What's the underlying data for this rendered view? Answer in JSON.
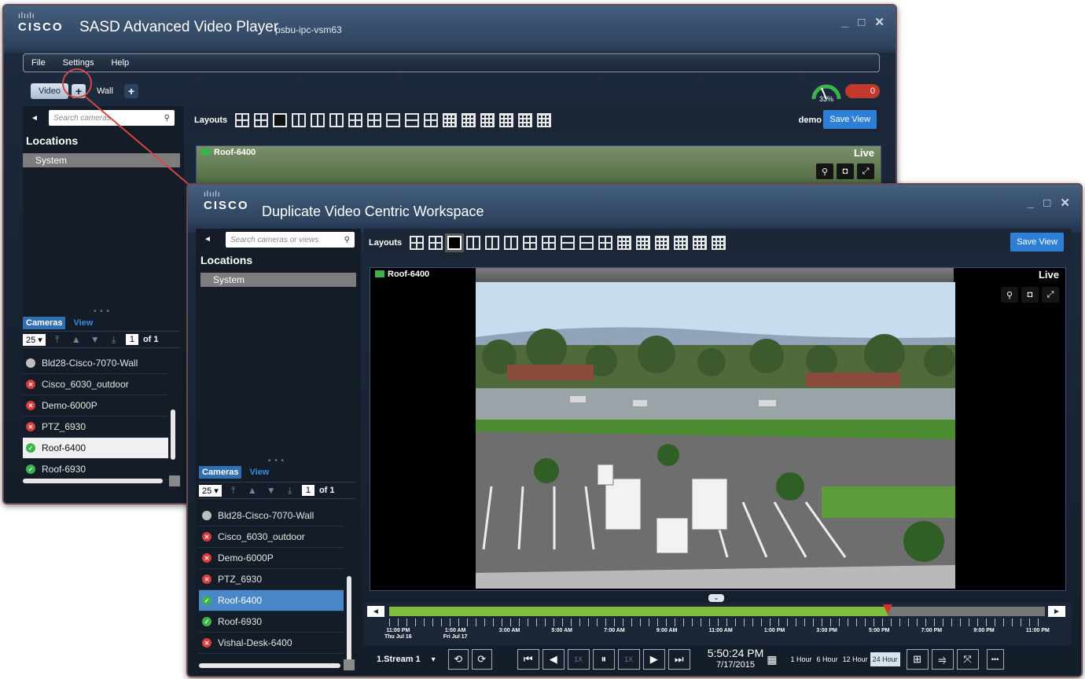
{
  "back_window": {
    "logo_bars": "ılıılı",
    "logo_word": "CISCO",
    "title": "SASD Advanced Video Player",
    "host": "psbu-ipc-vsm63",
    "window_controls": "_ □ ✕",
    "menu": [
      "File",
      "Settings",
      "Help"
    ],
    "tabs": [
      "Video",
      "Wall"
    ],
    "plus": "+",
    "gauge_percent": "33%",
    "alert_count": "0",
    "collapse_arrow": "◄",
    "search_placeholder": "Search cameras",
    "search_icon": "⚲",
    "locations_heading": "Locations",
    "locations": [
      "System"
    ],
    "splitter": "• • •",
    "camera_tabs": [
      "Cameras",
      "View"
    ],
    "pager": {
      "per_page": "25 ▾",
      "first": "⤒",
      "prev": "▲",
      "next": "▼",
      "last": "⤓",
      "page": "1",
      "of": "of 1"
    },
    "cameras": [
      {
        "name": "Bld28-Cisco-7070-Wall",
        "status": "gray",
        "glyph": ""
      },
      {
        "name": "Cisco_6030_outdoor",
        "status": "red",
        "glyph": "✕"
      },
      {
        "name": "Demo-6000P",
        "status": "red",
        "glyph": "✕"
      },
      {
        "name": "PTZ_6930",
        "status": "red",
        "glyph": "✕"
      },
      {
        "name": "Roof-6400",
        "status": "green",
        "glyph": "✓",
        "selected": true
      },
      {
        "name": "Roof-6930",
        "status": "green",
        "glyph": "✓"
      }
    ],
    "layouts_label": "Layouts",
    "user": "demo",
    "save_view": "Save View",
    "tile": {
      "name": "Roof-6400",
      "status": "Live",
      "tools": [
        "⚲",
        "◘",
        "⤢"
      ]
    }
  },
  "front_window": {
    "logo_bars": "ılıılı",
    "logo_word": "CISCO",
    "title": "Duplicate Video Centric Workspace",
    "window_controls": "_ □ ✕",
    "collapse_arrow": "◄",
    "search_placeholder": "Search cameras or views",
    "search_icon": "⚲",
    "locations_heading": "Locations",
    "locations": [
      "System"
    ],
    "splitter": "• • •",
    "camera_tabs": [
      "Cameras",
      "View"
    ],
    "pager": {
      "per_page": "25 ▾",
      "first": "⤒",
      "prev": "▲",
      "next": "▼",
      "last": "⤓",
      "page": "1",
      "of": "of 1"
    },
    "cameras": [
      {
        "name": "Bld28-Cisco-7070-Wall",
        "status": "gray",
        "glyph": ""
      },
      {
        "name": "Cisco_6030_outdoor",
        "status": "red",
        "glyph": "✕"
      },
      {
        "name": "Demo-6000P",
        "status": "red",
        "glyph": "✕"
      },
      {
        "name": "PTZ_6930",
        "status": "red",
        "glyph": "✕"
      },
      {
        "name": "Roof-6400",
        "status": "green",
        "glyph": "✓",
        "selected": true
      },
      {
        "name": "Roof-6930",
        "status": "green",
        "glyph": "✓"
      },
      {
        "name": "Vishal-Desk-6400",
        "status": "red",
        "glyph": "✕"
      }
    ],
    "layouts_label": "Layouts",
    "save_view": "Save View",
    "tile": {
      "name": "Roof-6400",
      "status": "Live",
      "tools": [
        "⚲",
        "◘",
        "⤢"
      ]
    },
    "timeline": {
      "left_arrow": "◄",
      "right_arrow": "►",
      "expand": "⌄",
      "progress": 0.76,
      "tick_labels": [
        [
          "11:00 PM",
          "Thu Jul 16"
        ],
        [
          "1:00 AM",
          "Fri Jul 17"
        ],
        [
          "3:00 AM",
          ""
        ],
        [
          "5:00 AM",
          ""
        ],
        [
          "7:00 AM",
          ""
        ],
        [
          "9:00 AM",
          ""
        ],
        [
          "11:00 AM",
          ""
        ],
        [
          "1:00 PM",
          ""
        ],
        [
          "3:00 PM",
          ""
        ],
        [
          "5:00 PM",
          ""
        ],
        [
          "7:00 PM",
          ""
        ],
        [
          "9:00 PM",
          ""
        ],
        [
          "11:00 PM",
          ""
        ]
      ]
    },
    "controls": {
      "stream": "1.Stream 1",
      "stream_caret": "▾",
      "sync_icons": [
        "⟲",
        "⟳"
      ],
      "skip_back": "⏮",
      "step_back": "◀",
      "speed_back": "1X",
      "pause": "⏸",
      "speed_fwd": "1X",
      "play": "▶",
      "skip_fwd": "⏭",
      "time": "5:50:24 PM",
      "date": "7/17/2015",
      "calendar_icon": "▦",
      "ranges": [
        "1 Hour",
        "6 Hour",
        "12 Hour",
        "24 Hour"
      ],
      "active_range": "24 Hour",
      "right_icons": [
        "⊞",
        "⥤",
        "⤧",
        "•••"
      ]
    }
  }
}
